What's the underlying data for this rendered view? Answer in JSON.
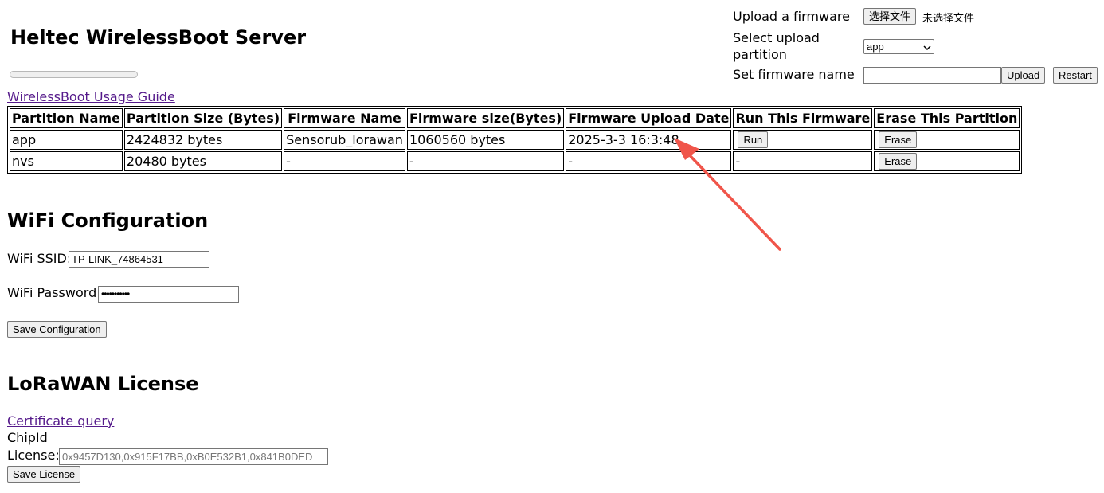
{
  "header": {
    "title": "Heltec WirelessBoot Server",
    "upload_progress": 0
  },
  "upload_panel": {
    "upload_label": "Upload a firmware",
    "choose_file_button": "选择文件",
    "no_file_text": "未选择文件",
    "partition_label_line1": "Select upload",
    "partition_label_line2": "partition",
    "partition_value": "app",
    "firmware_name_label": "Set firmware name",
    "firmware_name_value": "",
    "upload_button": "Upload",
    "restart_button": "Restart"
  },
  "guide_link": "WirelessBoot Usage Guide",
  "partition_table": {
    "headers": [
      "Partition Name",
      "Partition Size (Bytes)",
      "Firmware Name",
      "Firmware size(Bytes)",
      "Firmware Upload Date",
      "Run This Firmware",
      "Erase This Partition"
    ],
    "rows": [
      {
        "name": "app",
        "size": "2424832 bytes",
        "fw_name": "Sensorub_lorawan",
        "fw_size": "1060560 bytes",
        "date": "2025-3-3 16:3:48",
        "run": "Run",
        "erase": "Erase"
      },
      {
        "name": "nvs",
        "size": "20480 bytes",
        "fw_name": "-",
        "fw_size": "-",
        "date": "-",
        "run": "-",
        "erase": "Erase"
      }
    ]
  },
  "wifi": {
    "heading": "WiFi Configuration",
    "ssid_label": "WiFi SSID:",
    "ssid_value": "TP-LINK_74864531",
    "password_label": "WiFi Password:",
    "password_value": "•••••••••••",
    "save_button": "Save Configuration"
  },
  "lorawan": {
    "heading": "LoRaWAN License",
    "cert_link": "Certificate query",
    "chipid_label": "ChipId",
    "license_label": "License:",
    "license_placeholder": "0x9457D130,0x915F17BB,0xB0E532B1,0x841B0DED",
    "save_button": "Save License"
  },
  "annotation": {
    "arrow_color": "#f0554a"
  }
}
